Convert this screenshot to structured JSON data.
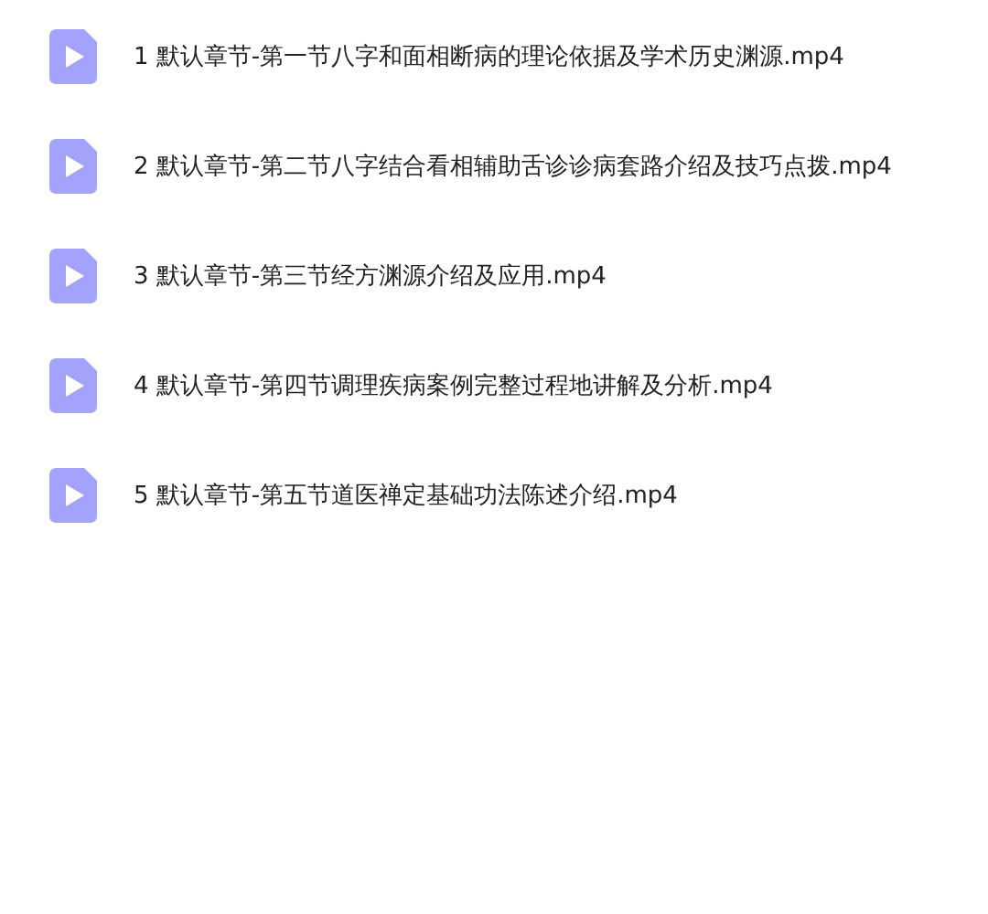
{
  "files": [
    {
      "name": "1 默认章节-第一节八字和面相断病的理论依据及学术历史渊源.mp4"
    },
    {
      "name": "2 默认章节-第二节八字结合看相辅助舌诊诊病套路介绍及技巧点拨.mp4"
    },
    {
      "name": "3 默认章节-第三节经方渊源介绍及应用.mp4"
    },
    {
      "name": "4 默认章节-第四节调理疾病案例完整过程地讲解及分析.mp4"
    },
    {
      "name": "5 默认章节-第五节道医禅定基础功法陈述介绍.mp4"
    }
  ]
}
